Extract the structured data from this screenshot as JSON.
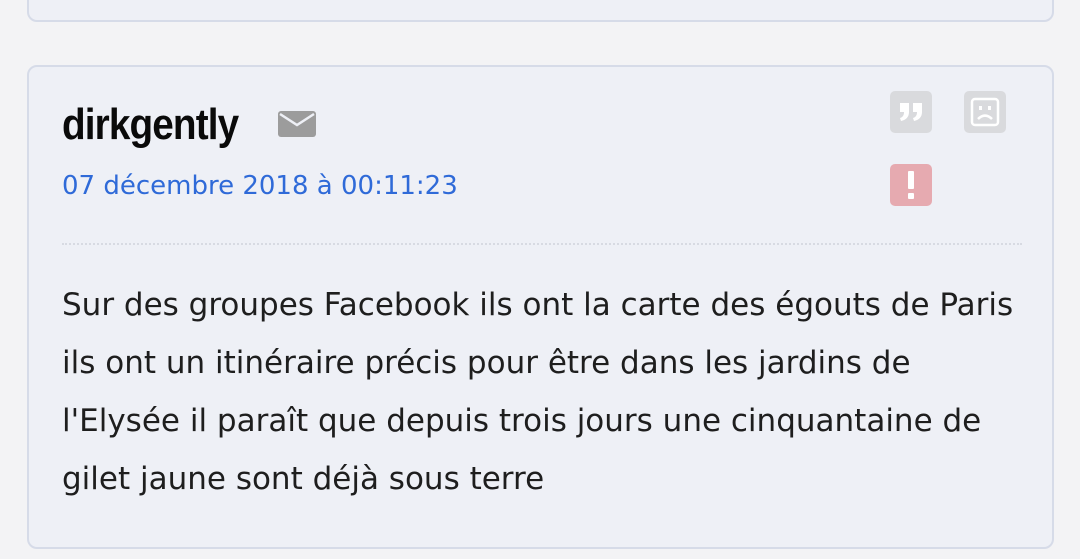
{
  "post": {
    "author": "dirkgently",
    "date": "07 décembre 2018 à 00:11:23",
    "body": "Sur des groupes Facebook ils ont la carte des égouts de Paris ils ont un itinéraire précis pour être dans les jardins de l'Elysée il paraît que depuis trois jours une cinquantaine de gilet jaune sont déjà sous terre"
  },
  "icons": {
    "mail": "envelope-icon",
    "quote": "quote-icon",
    "sad": "sad-face-icon",
    "report": "exclamation-icon"
  },
  "colors": {
    "date_link": "#2f6ad8",
    "report_bg": "#e6aab0",
    "icon_bg": "#d9dadd",
    "card_bg": "#eef0f6"
  }
}
